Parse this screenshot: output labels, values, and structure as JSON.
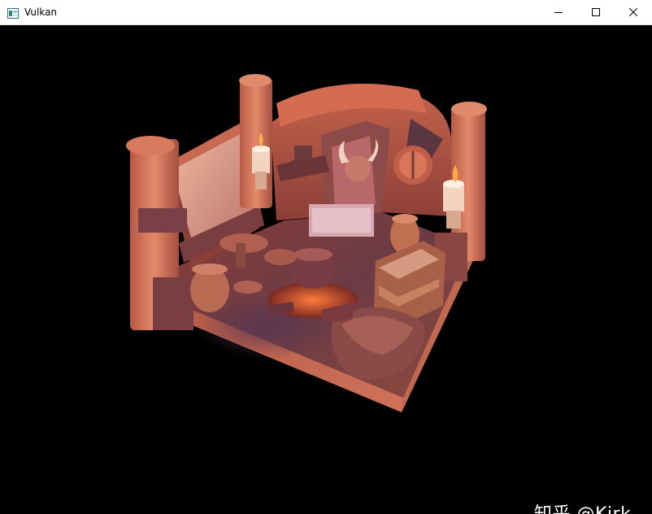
{
  "window": {
    "title": "Vulkan",
    "icons": {
      "app": "vulkan-window-icon",
      "minimize": "minimize-icon",
      "maximize": "maximize-icon",
      "close": "close-icon"
    }
  },
  "viewport": {
    "background": "#000000",
    "scene": "3d-rendered-room-diorama"
  },
  "watermark": {
    "text": "知乎 @Kirk"
  }
}
